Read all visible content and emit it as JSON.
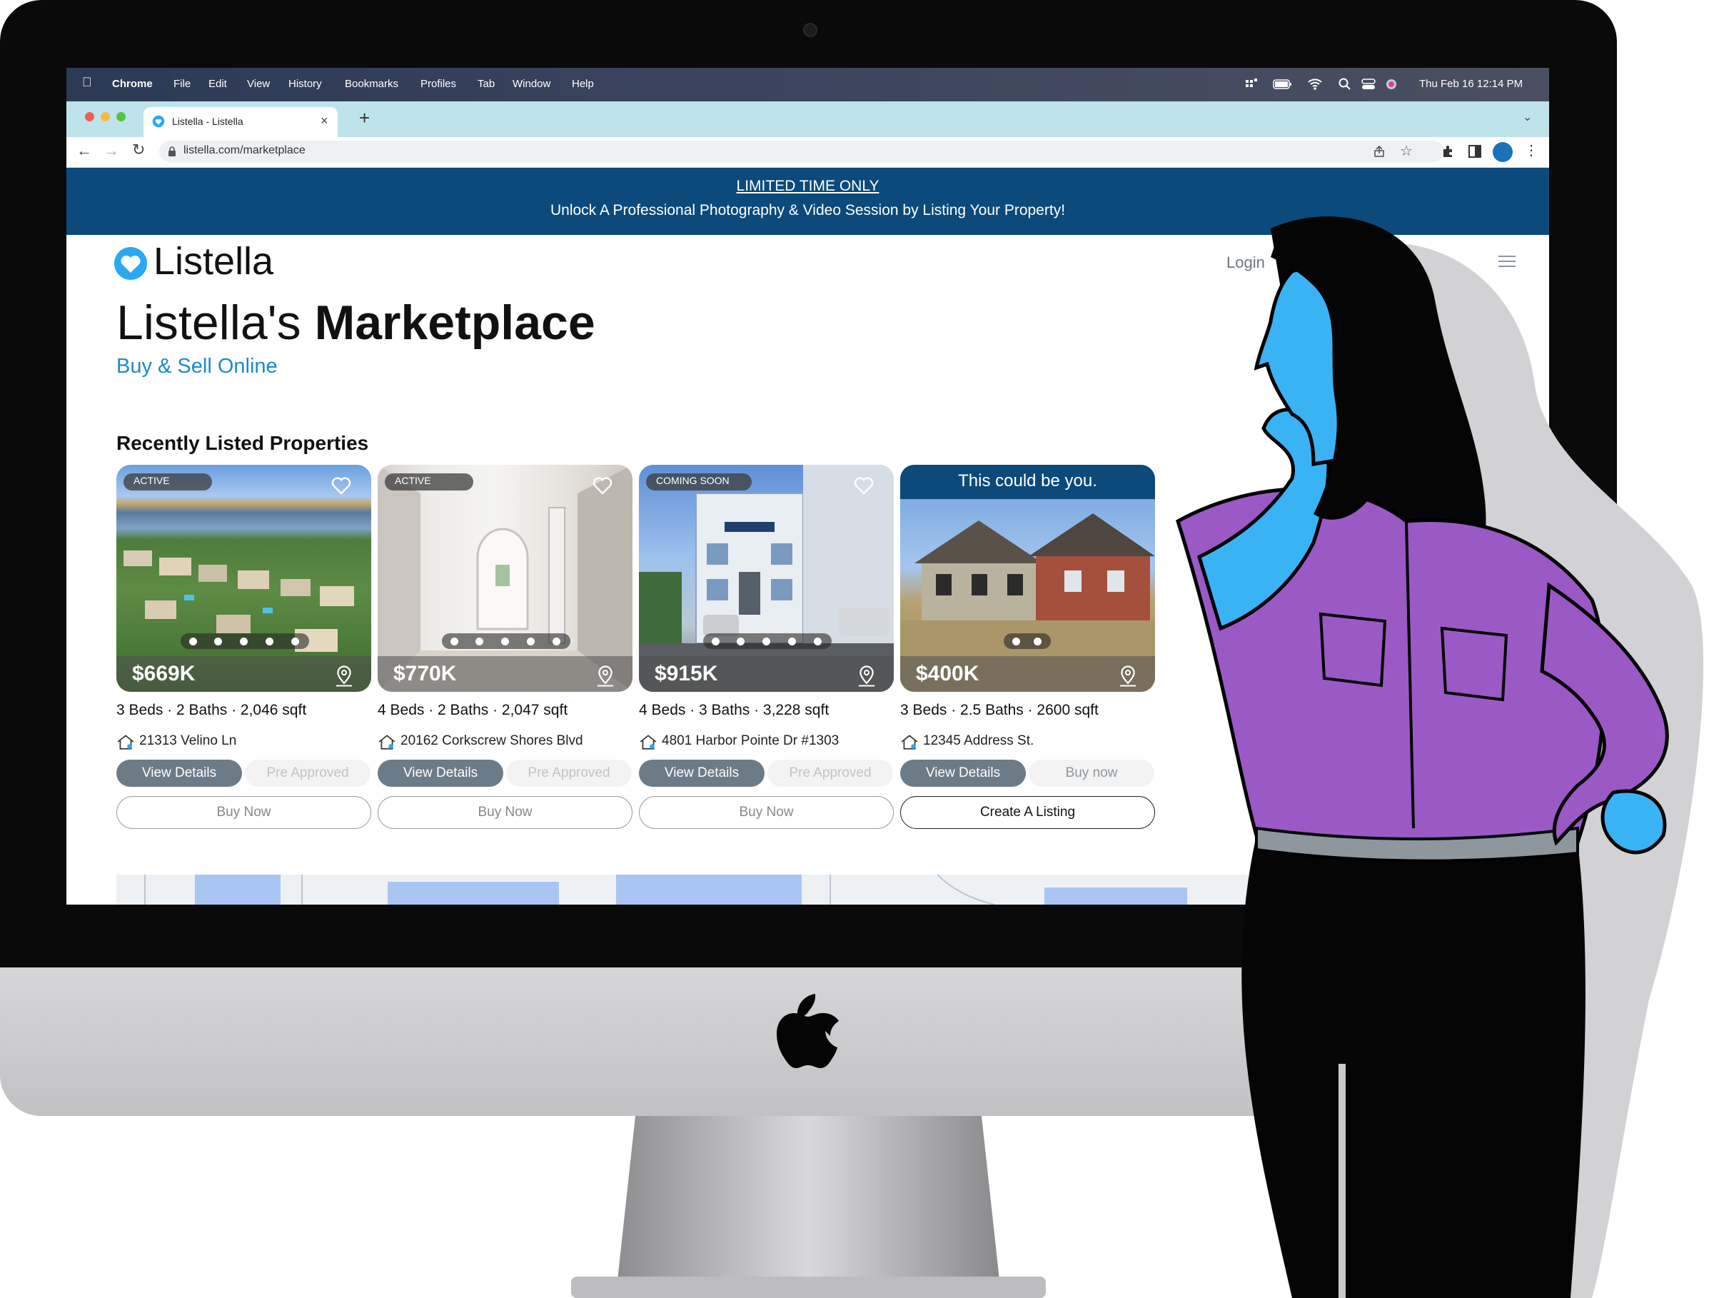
{
  "menubar": {
    "app": "Chrome",
    "items": [
      "File",
      "Edit",
      "View",
      "History",
      "Bookmarks",
      "Profiles",
      "Tab",
      "Window",
      "Help"
    ],
    "clock": "Thu Feb 16  12:14 PM"
  },
  "browser": {
    "tab_title": "Listella - Listella",
    "new_tab": "+",
    "url": "listella.com/marketplace"
  },
  "promo": {
    "headline": "LIMITED TIME ONLY",
    "text": "Unlock A Professional Photography & Video Session by Listing Your Property!"
  },
  "header": {
    "logo": "Listella",
    "login": "Login"
  },
  "hero": {
    "title_light": "Listella's",
    "title_bold": "Marketplace",
    "subtitle": "Buy & Sell Online"
  },
  "section": {
    "title": "Recently Listed Properties"
  },
  "cards": [
    {
      "badge": "ACTIVE",
      "price": "$669K",
      "facts": "3 Beds · 2 Baths · 2,046 sqft",
      "address": "21313 Velino Ln",
      "view": "View Details",
      "secondary": "Pre Approved",
      "primary": "Buy Now"
    },
    {
      "badge": "ACTIVE",
      "price": "$770K",
      "facts": "4 Beds · 2 Baths · 2,047 sqft",
      "address": "20162 Corkscrew Shores Blvd",
      "view": "View Details",
      "secondary": "Pre Approved",
      "primary": "Buy Now"
    },
    {
      "badge": "COMING SOON",
      "price": "$915K",
      "facts": "4 Beds · 3 Baths · 3,228 sqft",
      "address": "4801 Harbor Pointe Dr #1303",
      "view": "View Details",
      "secondary": "Pre Approved",
      "primary": "Buy Now"
    },
    {
      "banner": "This could be you.",
      "price": "$400K",
      "facts": "3 Beds · 2.5 Baths · 2600 sqft",
      "address": "12345 Address St.",
      "view": "View Details",
      "secondary": "Buy now",
      "primary": "Create A Listing"
    }
  ],
  "colors": {
    "promo_bg": "#0b4a7a",
    "accent_blue": "#1a8ad1",
    "button_gray": "#6c7b88",
    "figure_skin": "#3ab3f5",
    "figure_shirt": "#9b59c6"
  }
}
